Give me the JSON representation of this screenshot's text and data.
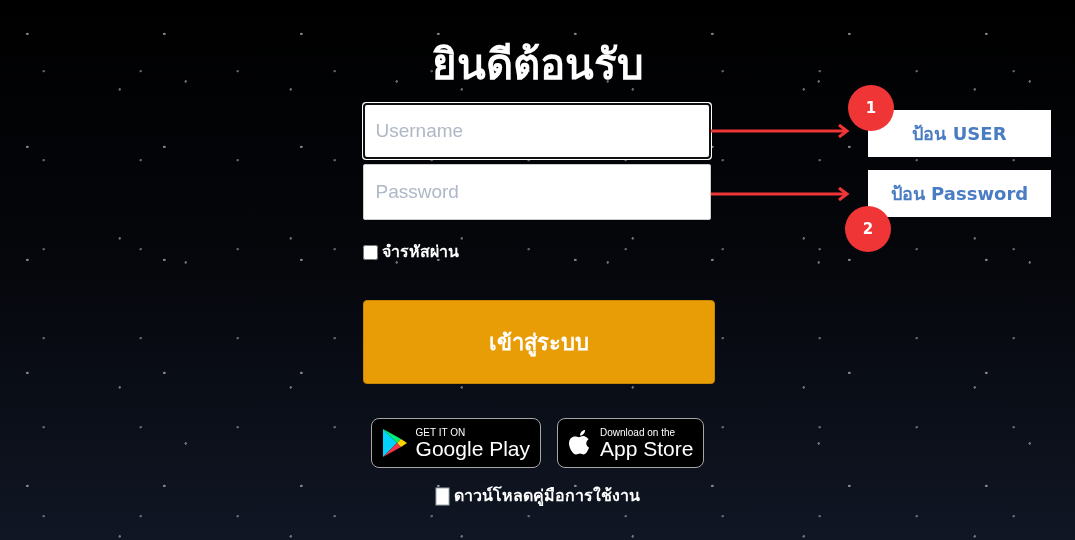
{
  "title": "ยินดีต้อนรับ",
  "fields": [
    {
      "placeholder": "Username"
    },
    {
      "placeholder": "Password"
    }
  ],
  "remember": {
    "label": "จำรหัสผ่าน",
    "checked": false
  },
  "login_button": "เข้าสู่ระบบ",
  "store_badges": [
    {
      "kind": "google_play",
      "small": "GET IT ON",
      "big": "Google Play"
    },
    {
      "kind": "app_store",
      "small": "Download on the",
      "big": "App Store"
    }
  ],
  "manual_link": "ดาวน์โหลดคู่มือการใช้งาน",
  "annotations": [
    {
      "number": "1",
      "label": "ป้อน USER"
    },
    {
      "number": "2",
      "label": "ป้อน Password"
    }
  ]
}
